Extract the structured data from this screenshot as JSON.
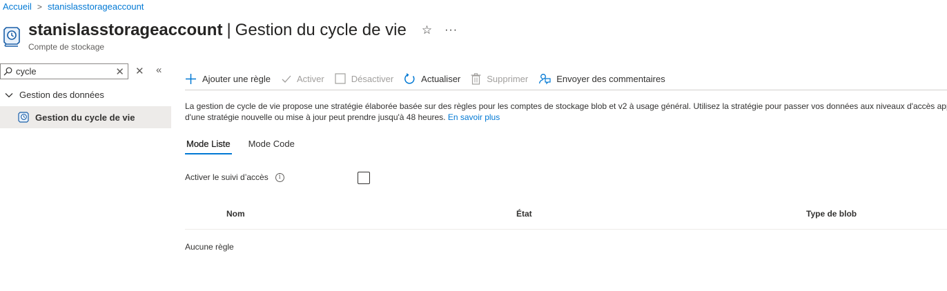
{
  "breadcrumb": {
    "home": "Accueil",
    "separator": ">",
    "current": "stanislasstorageaccount"
  },
  "header": {
    "title": "stanislasstorageaccount",
    "separator": "|",
    "page_title": "Gestion du cycle de vie",
    "subtitle": "Compte de stockage",
    "favorite_icon": "☆",
    "more_icon": "···"
  },
  "sidebar": {
    "search_value": "cycle",
    "clear_icon": "✕",
    "close_icon": "✕",
    "collapse_icon": "«",
    "group_label": "Gestion des données",
    "items": [
      {
        "label": "Gestion du cycle de vie",
        "selected": true
      }
    ]
  },
  "toolbar": {
    "add_rule": "Ajouter une règle",
    "enable": "Activer",
    "disable": "Désactiver",
    "refresh": "Actualiser",
    "delete": "Supprimer",
    "feedback": "Envoyer des commentaires"
  },
  "description": {
    "line1": "La gestion de cycle de vie propose une stratégie élaborée basée sur des règles pour les comptes de stockage blob et v2 à usage général. Utilisez la stratégie pour passer vos données aux niveaux d'accès appropriés ou les faire expirer à la fin du cycle de vie des données. L'application",
    "line2": "d'une stratégie nouvelle ou mise à jour peut prendre jusqu'à 48 heures.",
    "learn_more": "En savoir plus"
  },
  "tabs": [
    {
      "label": "Mode Liste",
      "active": true
    },
    {
      "label": "Mode Code",
      "active": false
    }
  ],
  "access_tracking": {
    "label": "Activer le suivi d’accès",
    "info_icon": "i",
    "checked": false
  },
  "table": {
    "columns": [
      "Nom",
      "État",
      "Type de blob"
    ],
    "empty_text": "Aucune règle"
  },
  "colors": {
    "accent": "#0078d4",
    "text": "#323130",
    "disabled": "#a19f9d",
    "selected_bg": "#edebe9"
  }
}
